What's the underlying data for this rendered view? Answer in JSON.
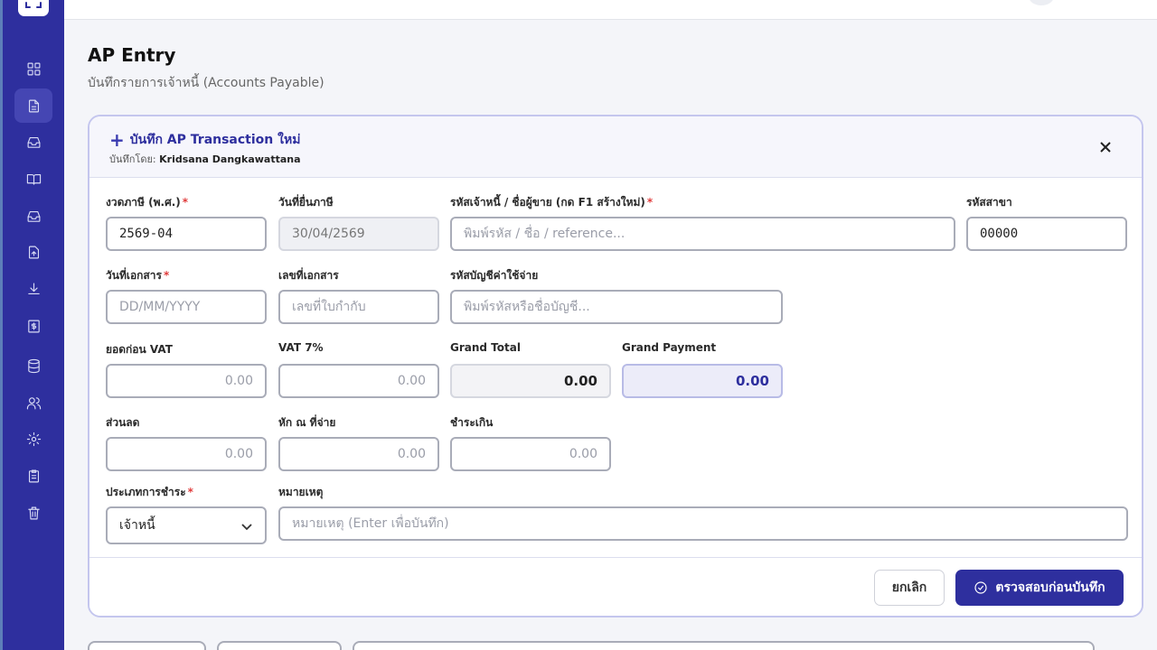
{
  "page": {
    "title": "AP Entry",
    "subtitle": "บันทึกรายการเจ้าหนี้ (Accounts Payable)"
  },
  "card": {
    "title": "บันทึก AP Transaction ใหม่",
    "recorded_by_label": "บันทึกโดย:",
    "recorded_by_name": "Kridsana Dangkawattana"
  },
  "form": {
    "period": {
      "label": "งวดภาษี (พ.ศ.)",
      "value": "2569-04",
      "required": "*"
    },
    "tax_filing_date": {
      "label": "วันที่ยื่นภาษี",
      "value": "30/04/2569"
    },
    "vendor": {
      "label": "รหัสเจ้าหนี้ / ชื่อผู้ขาย (กด F1 สร้างใหม่)",
      "placeholder": "พิมพ์รหัส / ชื่อ / reference...",
      "required": "*"
    },
    "branch_code": {
      "label": "รหัสสาขา",
      "value": "00000"
    },
    "document_date": {
      "label": "วันที่เอกสาร",
      "placeholder": "DD/MM/YYYY",
      "required": "*"
    },
    "document_no": {
      "label": "เลขที่เอกสาร",
      "placeholder": "เลขที่ใบกำกับ"
    },
    "expense_account": {
      "label": "รหัสบัญชีค่าใช้จ่าย",
      "placeholder": "พิมพ์รหัสหรือชื่อบัญชี..."
    },
    "amount_before_vat": {
      "label": "ยอดก่อน VAT",
      "value": "0.00"
    },
    "vat": {
      "label": "VAT 7%",
      "value": "0.00"
    },
    "grand_total": {
      "label": "Grand Total",
      "value": "0.00"
    },
    "grand_payment": {
      "label": "Grand Payment",
      "value": "0.00"
    },
    "discount": {
      "label": "ส่วนลด",
      "value": "0.00"
    },
    "withholding": {
      "label": "หัก ณ ที่จ่าย",
      "value": "0.00"
    },
    "overpayment": {
      "label": "ชำระเกิน",
      "value": "0.00"
    },
    "payment_type": {
      "label": "ประเภทการชำระ",
      "value": "เจ้าหนี้",
      "required": "*"
    },
    "remark": {
      "label": "หมายเหตุ",
      "placeholder": "หมายเหตุ (Enter เพื่อบันทึก)"
    }
  },
  "actions": {
    "cancel": "ยกเลิก",
    "submit": "ตรวจสอบก่อนบันทึก"
  },
  "sidebar": {
    "icons": [
      "dashboard-icon",
      "document-icon",
      "inbox-icon",
      "book-icon",
      "inbox-icon",
      "file-upload-icon",
      "download-icon",
      "dollar-file-icon",
      "database-icon",
      "users-icon",
      "gear-icon",
      "clipboard-icon",
      "trash-icon"
    ],
    "active_index": 1
  },
  "colors": {
    "primary": "#2e2f9e",
    "sidebar": "#2e2f9e",
    "required": "#e03b3b"
  }
}
